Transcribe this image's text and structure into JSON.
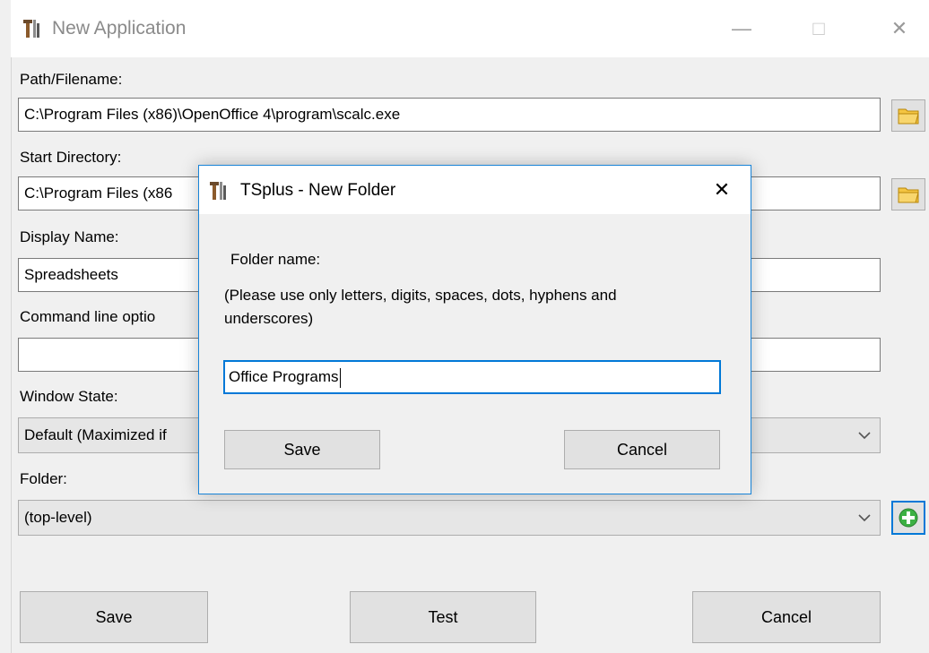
{
  "main_window": {
    "title": "New Application",
    "controls": {
      "minimize": "—",
      "maximize": "□",
      "close": "✕"
    }
  },
  "form": {
    "path": {
      "label": "Path/Filename:",
      "value": "C:\\Program Files (x86)\\OpenOffice 4\\program\\scalc.exe"
    },
    "start_dir": {
      "label": "Start Directory:",
      "value": "C:\\Program Files (x86"
    },
    "display_name": {
      "label": "Display Name:",
      "value": "Spreadsheets"
    },
    "cmd_options": {
      "label": "Command line optio",
      "value": ""
    },
    "window_state": {
      "label": "Window State:",
      "value": "Default (Maximized if"
    },
    "folder": {
      "label": "Folder:",
      "value": "(top-level)"
    }
  },
  "buttons": {
    "save": "Save",
    "test": "Test",
    "cancel": "Cancel"
  },
  "dialog": {
    "title": "TSplus - New Folder",
    "close": "✕",
    "folder_label": "Folder name:",
    "hint_line1": "(Please use only letters, digits, spaces, dots, hyphens and",
    "hint_line2": "underscores)",
    "input_value": "Office Programs",
    "save": "Save",
    "cancel": "Cancel"
  },
  "colors": {
    "accent": "#0078d7",
    "folder_icon": "#f4c542",
    "add_icon": "#3cb043"
  },
  "icons": {
    "app": "tools-icon",
    "browse": "folder-icon",
    "add": "add-circle-icon",
    "dropdown": "chevron-down-icon"
  }
}
